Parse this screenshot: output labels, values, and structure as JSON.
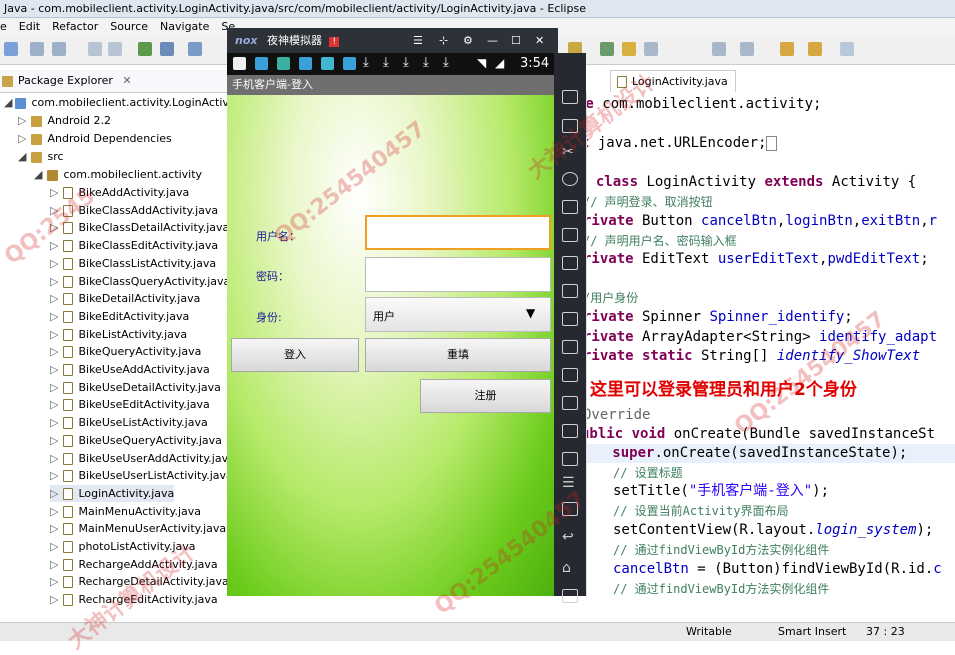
{
  "window_title": "Java - com.mobileclient.activity.LoginActivity.java/src/com/mobileclient/activity/LoginActivity.java - Eclipse",
  "menu": [
    "e",
    "Edit",
    "Refactor",
    "Source",
    "Navigate",
    "Se"
  ],
  "package_explorer": {
    "title": "Package Explorer",
    "close": "✕",
    "project": "com.mobileclient.activity.LoginActivity",
    "android": "Android 2.2",
    "deps": "Android Dependencies",
    "src": "src",
    "package": "com.mobileclient.activity",
    "files": [
      "BikeAddActivity.java",
      "BikeClassAddActivity.java",
      "BikeClassDetailActivity.java",
      "BikeClassEditActivity.java",
      "BikeClassListActivity.java",
      "BikeClassQueryActivity.java",
      "BikeDetailActivity.java",
      "BikeEditActivity.java",
      "BikeListActivity.java",
      "BikeQueryActivity.java",
      "BikeUseAddActivity.java",
      "BikeUseDetailActivity.java",
      "BikeUseEditActivity.java",
      "BikeUseListActivity.java",
      "BikeUseQueryActivity.java",
      "BikeUseUserAddActivity.java",
      "BikeUseUserListActivity.java",
      "LoginActivity.java",
      "MainMenuActivity.java",
      "MainMenuUserActivity.java",
      "photoListActivity.java",
      "RechargeAddActivity.java",
      "RechargeDetailActivity.java",
      "RechargeEditActivity.java"
    ]
  },
  "editor": {
    "tab": "LoginActivity.java",
    "tab_close": "✕",
    "annotation": "这里可以登录管理员和用户2个身份"
  },
  "emulator": {
    "title": "夜神模拟器",
    "logo": "nox",
    "badge": "!",
    "time": "3:54",
    "app_title": "手机客户端-登入",
    "username_label": "用户名：",
    "password_label": "密码：",
    "identity_label": "身份:",
    "identity_value": "用户",
    "login_button": "登入",
    "reset_button": "重填",
    "register_button": "注册"
  },
  "status_bar": {
    "mode": "Writable",
    "insert": "Smart Insert",
    "position": "37 : 23"
  },
  "watermarks": [
    "QQ:254540457",
    "大神计算机设计",
    "QQ:2545",
    "QQ:254540457",
    "大神计算机设计",
    "QQ:254540457"
  ],
  "colors": {
    "keyword": "#7f0055",
    "comment": "#3f7f5f",
    "field": "#0000c0",
    "string": "#2a00ff",
    "annotation_red": "#e00000"
  }
}
